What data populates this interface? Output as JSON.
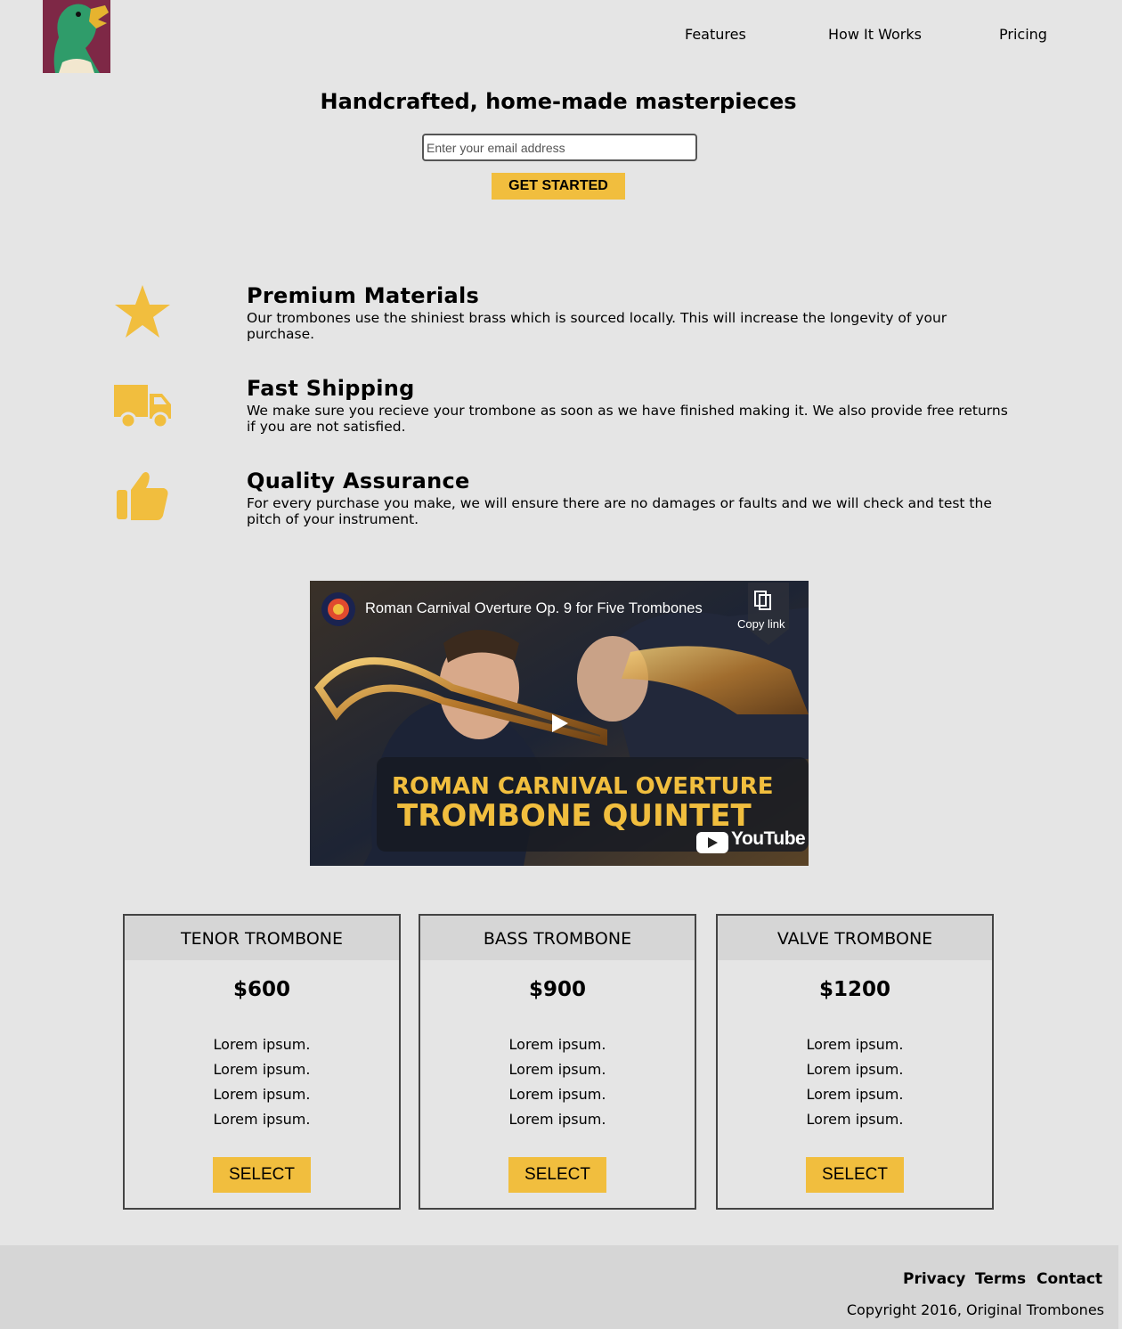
{
  "header": {
    "logo_alt": "Original Trombones duck logo",
    "nav": [
      {
        "label": "Features"
      },
      {
        "label": "How It Works"
      },
      {
        "label": "Pricing"
      }
    ]
  },
  "hero": {
    "title": "Handcrafted, home-made masterpieces",
    "email_placeholder": "Enter your email address",
    "cta_label": "GET STARTED"
  },
  "features": [
    {
      "icon": "star-icon",
      "title": "Premium Materials",
      "description": "Our trombones use the shiniest brass which is sourced locally. This will increase the longevity of your purchase."
    },
    {
      "icon": "truck-icon",
      "title": "Fast Shipping",
      "description": "We make sure you recieve your trombone as soon as we have finished making it. We also provide free returns if you are not satisfied."
    },
    {
      "icon": "thumbs-up-icon",
      "title": "Quality Assurance",
      "description": "For every purchase you make, we will ensure there are no damages or faults and we will check and test the pitch of your instrument."
    }
  ],
  "video": {
    "title": "Roman Carnival Overture Op. 9 for Five Trombones",
    "copy_link_label": "Copy link",
    "caption_line1": "ROMAN CARNIVAL OVERTURE",
    "caption_line2": "TROMBONE QUINTET",
    "brand": "YouTube"
  },
  "pricing": [
    {
      "name": "TENOR TROMBONE",
      "price": "$600",
      "features": [
        "Lorem ipsum.",
        "Lorem ipsum.",
        "Lorem ipsum.",
        "Lorem ipsum."
      ],
      "button": "SELECT"
    },
    {
      "name": "BASS TROMBONE",
      "price": "$900",
      "features": [
        "Lorem ipsum.",
        "Lorem ipsum.",
        "Lorem ipsum.",
        "Lorem ipsum."
      ],
      "button": "SELECT"
    },
    {
      "name": "VALVE TROMBONE",
      "price": "$1200",
      "features": [
        "Lorem ipsum.",
        "Lorem ipsum.",
        "Lorem ipsum.",
        "Lorem ipsum."
      ],
      "button": "SELECT"
    }
  ],
  "footer": {
    "links": [
      {
        "label": "Privacy"
      },
      {
        "label": "Terms"
      },
      {
        "label": "Contact"
      }
    ],
    "copyright": "Copyright 2016, Original Trombones"
  },
  "colors": {
    "accent": "#f1be3e",
    "background": "#e5e5e5",
    "footer_bg": "#d6d6d6",
    "logo_bg": "#7e2846"
  }
}
